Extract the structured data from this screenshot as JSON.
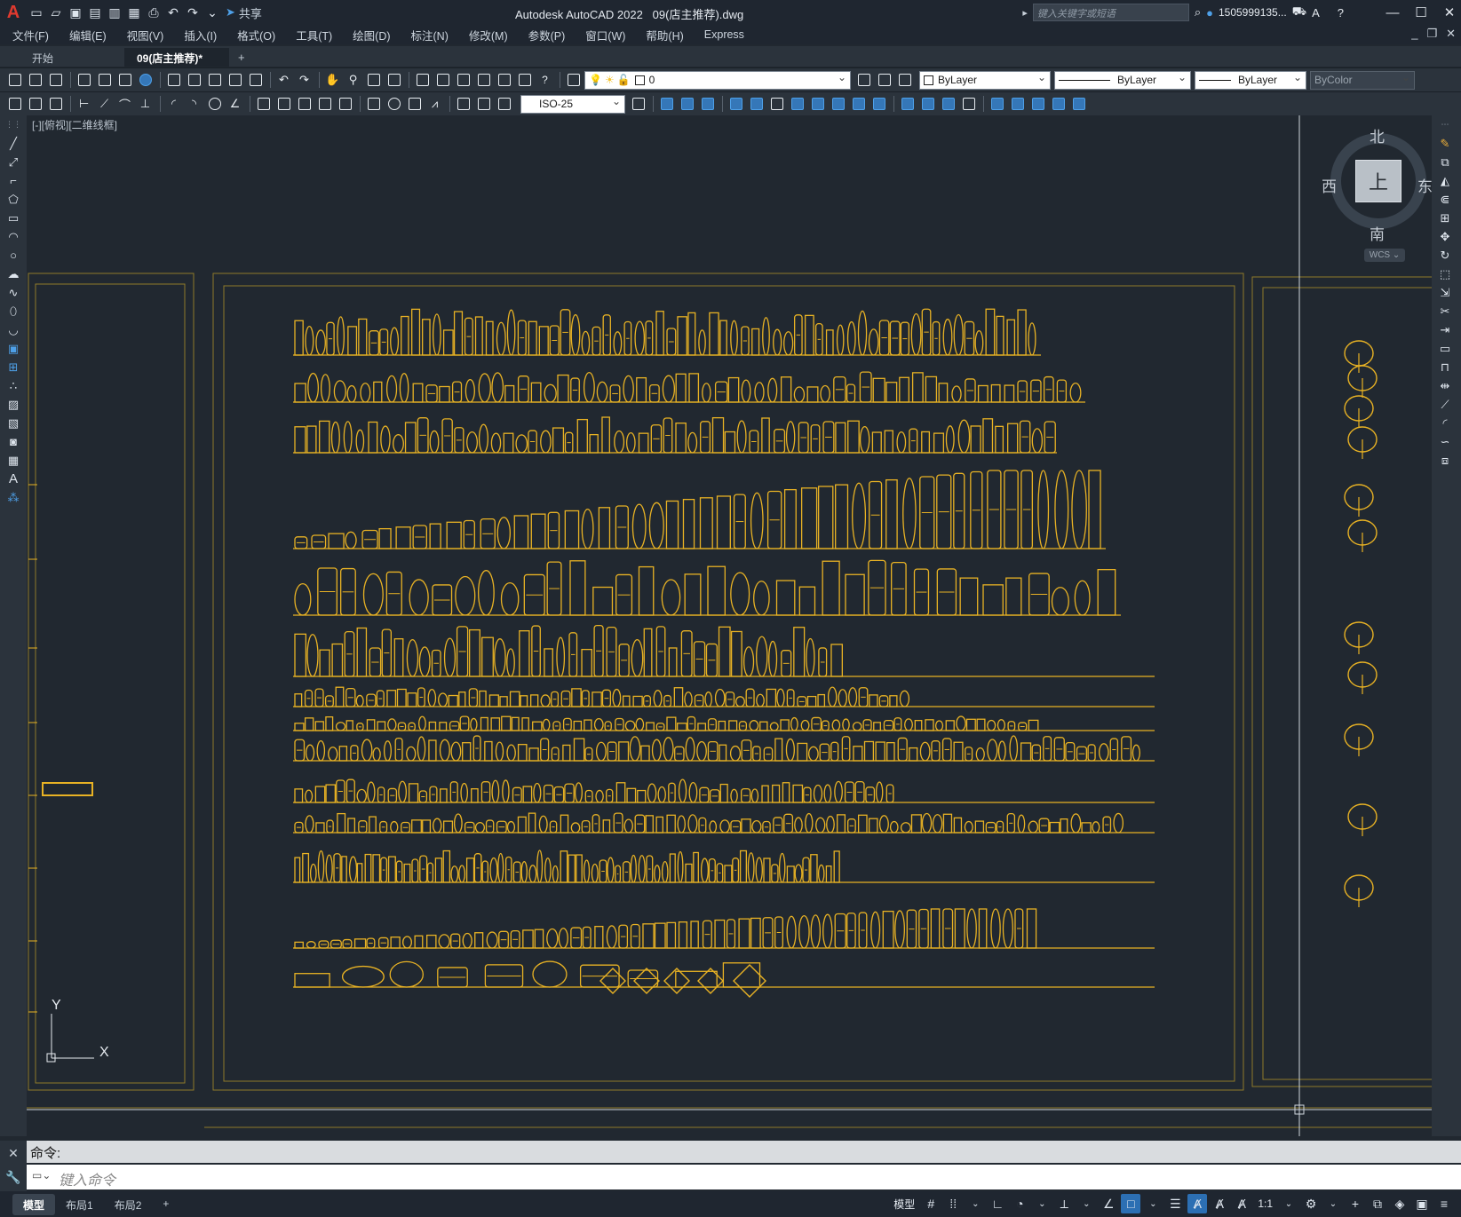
{
  "window": {
    "app_title": "Autodesk AutoCAD 2022",
    "file_title": "09(店主推荐).dwg",
    "share_label": "共享",
    "search_placeholder": "键入关键字或短语",
    "user_name": "1505999135...",
    "minimize": "—",
    "maximize": "☐",
    "close": "✕"
  },
  "menu": [
    "文件(F)",
    "编辑(E)",
    "视图(V)",
    "插入(I)",
    "格式(O)",
    "工具(T)",
    "绘图(D)",
    "标注(N)",
    "修改(M)",
    "参数(P)",
    "窗口(W)",
    "帮助(H)",
    "Express"
  ],
  "tabs": {
    "start": "开始",
    "doc": "09(店主推荐)*",
    "add": "+"
  },
  "properties": {
    "layer": "0",
    "color": "ByLayer",
    "linetype": "ByLayer",
    "lineweight": "ByLayer",
    "plotstyle": "ByColor",
    "dimstyle": "ISO-25"
  },
  "viewport": {
    "label": "[-][俯视][二维线框]",
    "cube_top": "上",
    "north": "北",
    "south": "南",
    "east": "东",
    "west": "西",
    "wcs": "WCS ⌄",
    "ucs_x": "X",
    "ucs_y": "Y"
  },
  "command": {
    "history": "命令:",
    "placeholder": "键入命令"
  },
  "status": {
    "tabs": [
      "模型",
      "布局1",
      "布局2"
    ],
    "add": "+",
    "model_label": "模型",
    "scale": "1:1"
  },
  "colors": {
    "accent": "#2c6fb3",
    "drawing_yellow": "#e8b224",
    "border_line": "#8f7a2a",
    "background": "#212830"
  }
}
